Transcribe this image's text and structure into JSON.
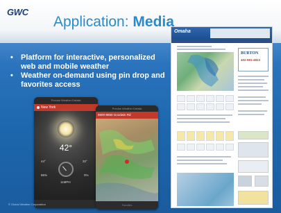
{
  "slide": {
    "logo_text": "GWC",
    "logo_sub": "",
    "title_prefix": "Application: ",
    "title_bold": "Media",
    "bullets": [
      "Platform for interactive, personalized web and mobile weather",
      "Weather on-demand using pin drop and favorites access"
    ],
    "bullet_marker": "•",
    "footer": "© Global Weather Corporation"
  },
  "phone1": {
    "app_title": "Precise Weather Details",
    "city": "New York",
    "temperature": "42°",
    "stats": {
      "left_top": "44°",
      "right_top": "32°",
      "left_bottom": "86%",
      "right_bottom": "0%",
      "wind": "11MPH"
    }
  },
  "phone2": {
    "app_title": "Precise Weather Details",
    "address": "8600-8650 Goodwin Rd",
    "nav": "Favorites"
  },
  "website": {
    "logo": "Omaha",
    "ad_name": "BURTON",
    "ad_phone": "402-991-4823"
  },
  "colors": {
    "title_blue": "#2b8ac9",
    "slide_blue": "#1d67ae",
    "phone_red": "#c0392b"
  }
}
